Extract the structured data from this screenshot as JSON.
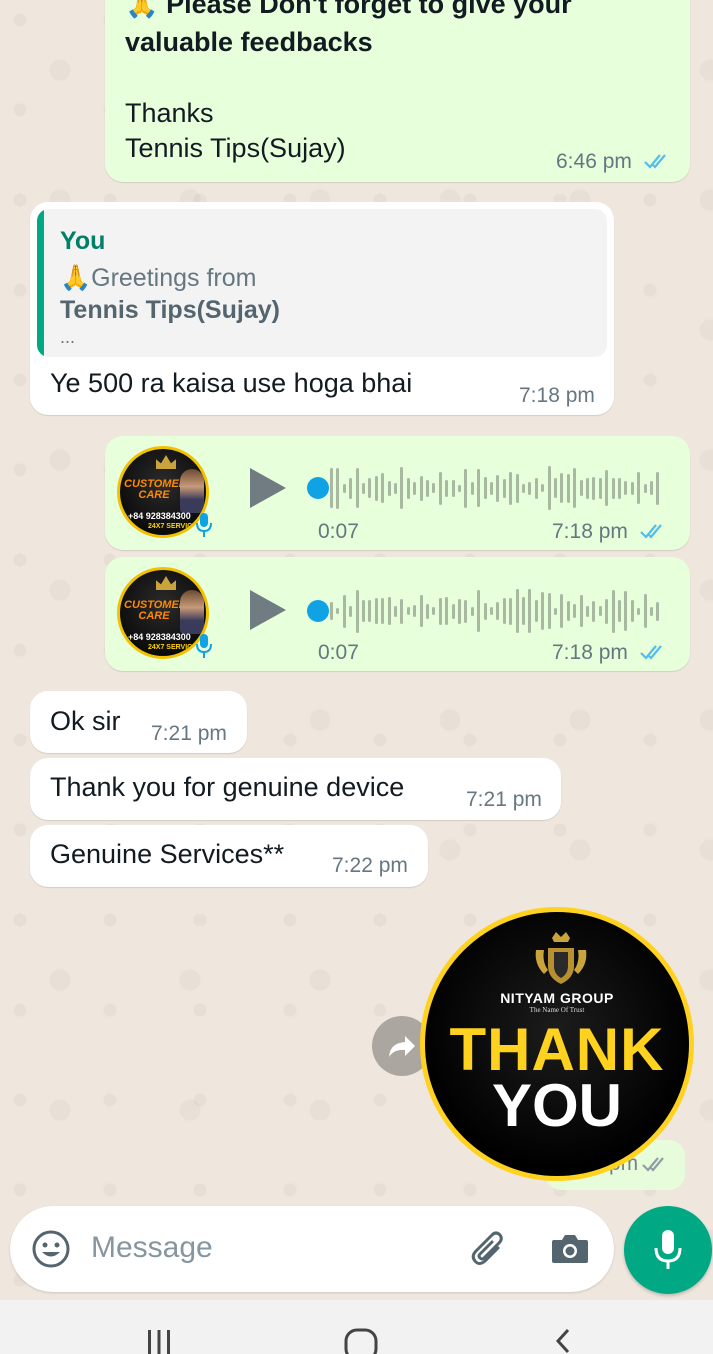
{
  "colors": {
    "outgoing_bubble": "#e7ffdb",
    "incoming_bubble": "#ffffff",
    "accent": "#00a884",
    "read_ticks": "#53bdeb",
    "wallpaper": "#efe7de"
  },
  "messages": {
    "m1": {
      "line_partial": "🙏 Please Don't forget to give your",
      "line2": "valuable feedbacks",
      "thanks": "Thanks",
      "signature": "Tennis Tips(Sujay)",
      "time": "6:46 pm",
      "status": "read"
    },
    "m2": {
      "quote_author": "You",
      "quote_line1": "🙏Greetings from",
      "quote_line2": "Tennis Tips(Sujay)",
      "quote_more": "...",
      "text": "Ye 500 ra kaisa use hoga bhai",
      "time": "7:18 pm"
    },
    "voice1": {
      "duration": "0:07",
      "time": "7:18 pm",
      "status": "read",
      "avatar_title": "CUSTOMER CARE",
      "avatar_phone": "+84 928384300",
      "avatar_service": "24X7 SERVICE",
      "progress": 0.0
    },
    "voice2": {
      "duration": "0:07",
      "time": "7:18 pm",
      "status": "read",
      "avatar_title": "CUSTOMER CARE",
      "avatar_phone": "+84 928384300",
      "avatar_service": "24X7 SERVICE",
      "progress": 0.0
    },
    "m3": {
      "text": "Ok sir",
      "time": "7:21 pm"
    },
    "m4": {
      "text": "Thank you for genuine device",
      "time": "7:21 pm"
    },
    "m5": {
      "text": "Genuine Services**",
      "time": "7:22 pm"
    },
    "sticker": {
      "brand": "NITYAM GROUP",
      "tagline": "The Name Of Trust",
      "line1": "THANK",
      "line2": "YOU",
      "time_partial": "pm",
      "status": "read"
    }
  },
  "composer": {
    "placeholder": "Message",
    "emoji_icon": "emoji-icon",
    "attach_icon": "paperclip-icon",
    "camera_icon": "camera-icon",
    "mic_icon": "microphone-icon"
  },
  "system_nav": {
    "recents_icon": "recents-icon",
    "home_icon": "home-icon",
    "back_icon": "back-icon"
  }
}
